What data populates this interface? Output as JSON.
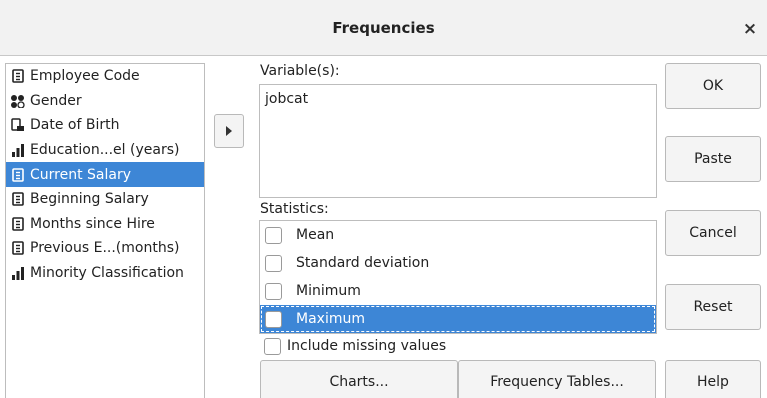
{
  "dialog": {
    "title": "Frequencies",
    "close_glyph": "×"
  },
  "variables": [
    {
      "label": "Employee Code",
      "icon": "scale-variable-icon",
      "selected": false
    },
    {
      "label": "Gender",
      "icon": "nominal-variable-icon",
      "selected": false
    },
    {
      "label": "Date of Birth",
      "icon": "date-variable-icon",
      "selected": false
    },
    {
      "label": "Education...el (years)",
      "icon": "ordinal-variable-icon",
      "selected": false
    },
    {
      "label": "Current Salary",
      "icon": "scale-variable-icon",
      "selected": true
    },
    {
      "label": "Beginning Salary",
      "icon": "scale-variable-icon",
      "selected": false
    },
    {
      "label": "Months since Hire",
      "icon": "scale-variable-icon",
      "selected": false
    },
    {
      "label": "Previous E...(months)",
      "icon": "scale-variable-icon",
      "selected": false
    },
    {
      "label": "Minority Classification",
      "icon": "ordinal-variable-icon",
      "selected": false
    }
  ],
  "target": {
    "label": "Variable(s):",
    "items": [
      "jobcat"
    ]
  },
  "statistics": {
    "label": "Statistics:",
    "items": [
      {
        "label": "Mean",
        "checked": false,
        "selected": false
      },
      {
        "label": "Standard deviation",
        "checked": false,
        "selected": false
      },
      {
        "label": "Minimum",
        "checked": false,
        "selected": false
      },
      {
        "label": "Maximum",
        "checked": false,
        "selected": true
      }
    ]
  },
  "options": {
    "include_missing": "Include missing values",
    "include_missing_checked": false
  },
  "buttons": {
    "ok": "OK",
    "paste": "Paste",
    "cancel": "Cancel",
    "reset": "Reset",
    "help": "Help",
    "charts": "Charts...",
    "frequency_tables": "Frequency Tables..."
  }
}
